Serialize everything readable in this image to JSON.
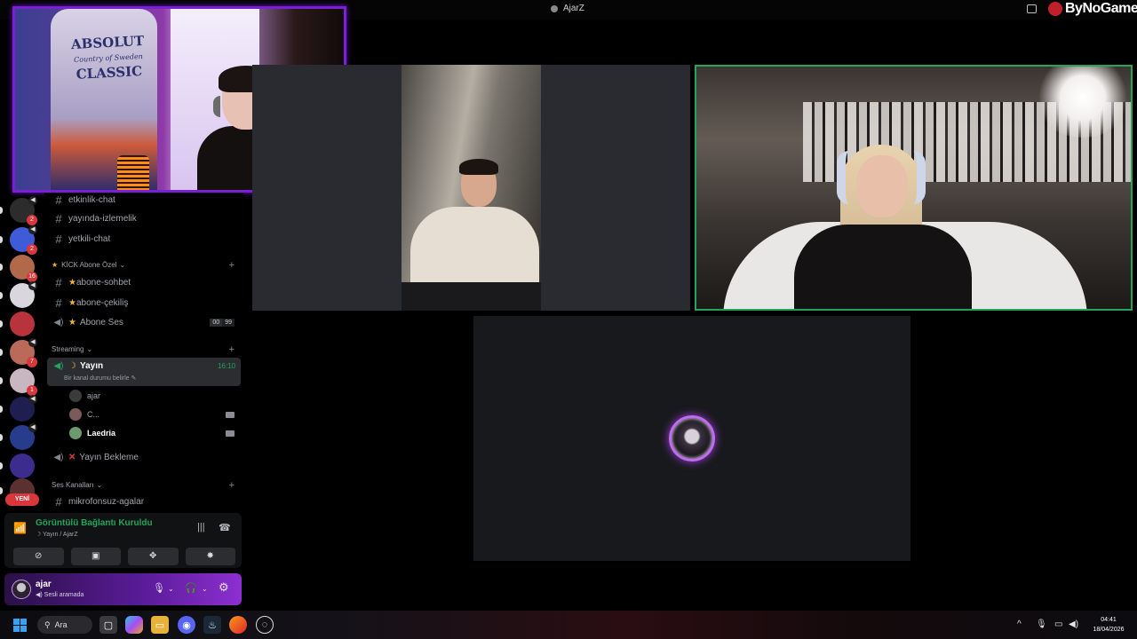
{
  "window": {
    "title": "AjarZ",
    "brand": "ByNoGame"
  },
  "webcam": {
    "bottle_text_1": "ABSOLUT",
    "bottle_text_2": "Country of Sweden",
    "bottle_text_3": "CLASSIC"
  },
  "servers": [
    {
      "badge": "2",
      "color": "#2c2c2c",
      "voice": true
    },
    {
      "badge": "2",
      "color": "#3f5bd8",
      "voice": true
    },
    {
      "badge": "16",
      "color": "#b06a4a",
      "voice": false
    },
    {
      "badge": "",
      "color": "#d9d6dd",
      "voice": true
    },
    {
      "badge": "",
      "color": "#b9333d",
      "voice": false
    },
    {
      "badge": "7",
      "color": "#b96a5a",
      "voice": true
    },
    {
      "badge": "1",
      "color": "#c8b7c0",
      "voice": false
    },
    {
      "badge": "",
      "color": "#1e1f50",
      "voice": true
    },
    {
      "badge": "",
      "color": "#283c8e",
      "voice": true
    },
    {
      "badge": "",
      "color": "#3b2c8e",
      "voice": false
    },
    {
      "badge": "",
      "color": "#5a3030",
      "voice": false
    }
  ],
  "new_label": "YENİ",
  "sidebar": {
    "channels_top": [
      "etkinlik-chat",
      "yayında-izlemelik",
      "yetkili-chat"
    ],
    "cat_kick": "KİCK Abone Özel",
    "kick_channels": [
      "abone-sohbet",
      "abone-çekiliş"
    ],
    "abone_ses": "Abone Ses",
    "abone_ses_count": "00",
    "abone_ses_limit": "99",
    "cat_streaming": "Streaming",
    "yayin": {
      "name": "Yayın",
      "time": "16:10",
      "status": "Bir kanal durumu belirle"
    },
    "members": [
      {
        "name": "ajar",
        "color": "#3b3b3b",
        "camera": false,
        "bold": false
      },
      {
        "name": "C...",
        "color": "#7a5a5a",
        "camera": true,
        "bold": false
      },
      {
        "name": "Laedria",
        "color": "#6d9a6d",
        "camera": true,
        "bold": true
      }
    ],
    "yayin_bekleme": "Yayın Bekleme",
    "cat_ses": "Ses Kanalları",
    "mikrofonsuz": "mikrofonsuz-agalar"
  },
  "voice_panel": {
    "title": "Görüntülü Bağlantı Kuruldu",
    "subtitle": "Yayın / AjarZ"
  },
  "user_panel": {
    "name": "ajar",
    "status": "Sesli aramada"
  },
  "taskbar": {
    "search_label": "Ara",
    "time": "04:41",
    "date": "18/04/2026"
  },
  "colors": {
    "accent_green": "#23a55a",
    "accent_purple": "#7a1fd6",
    "badge_red": "#da373c"
  }
}
